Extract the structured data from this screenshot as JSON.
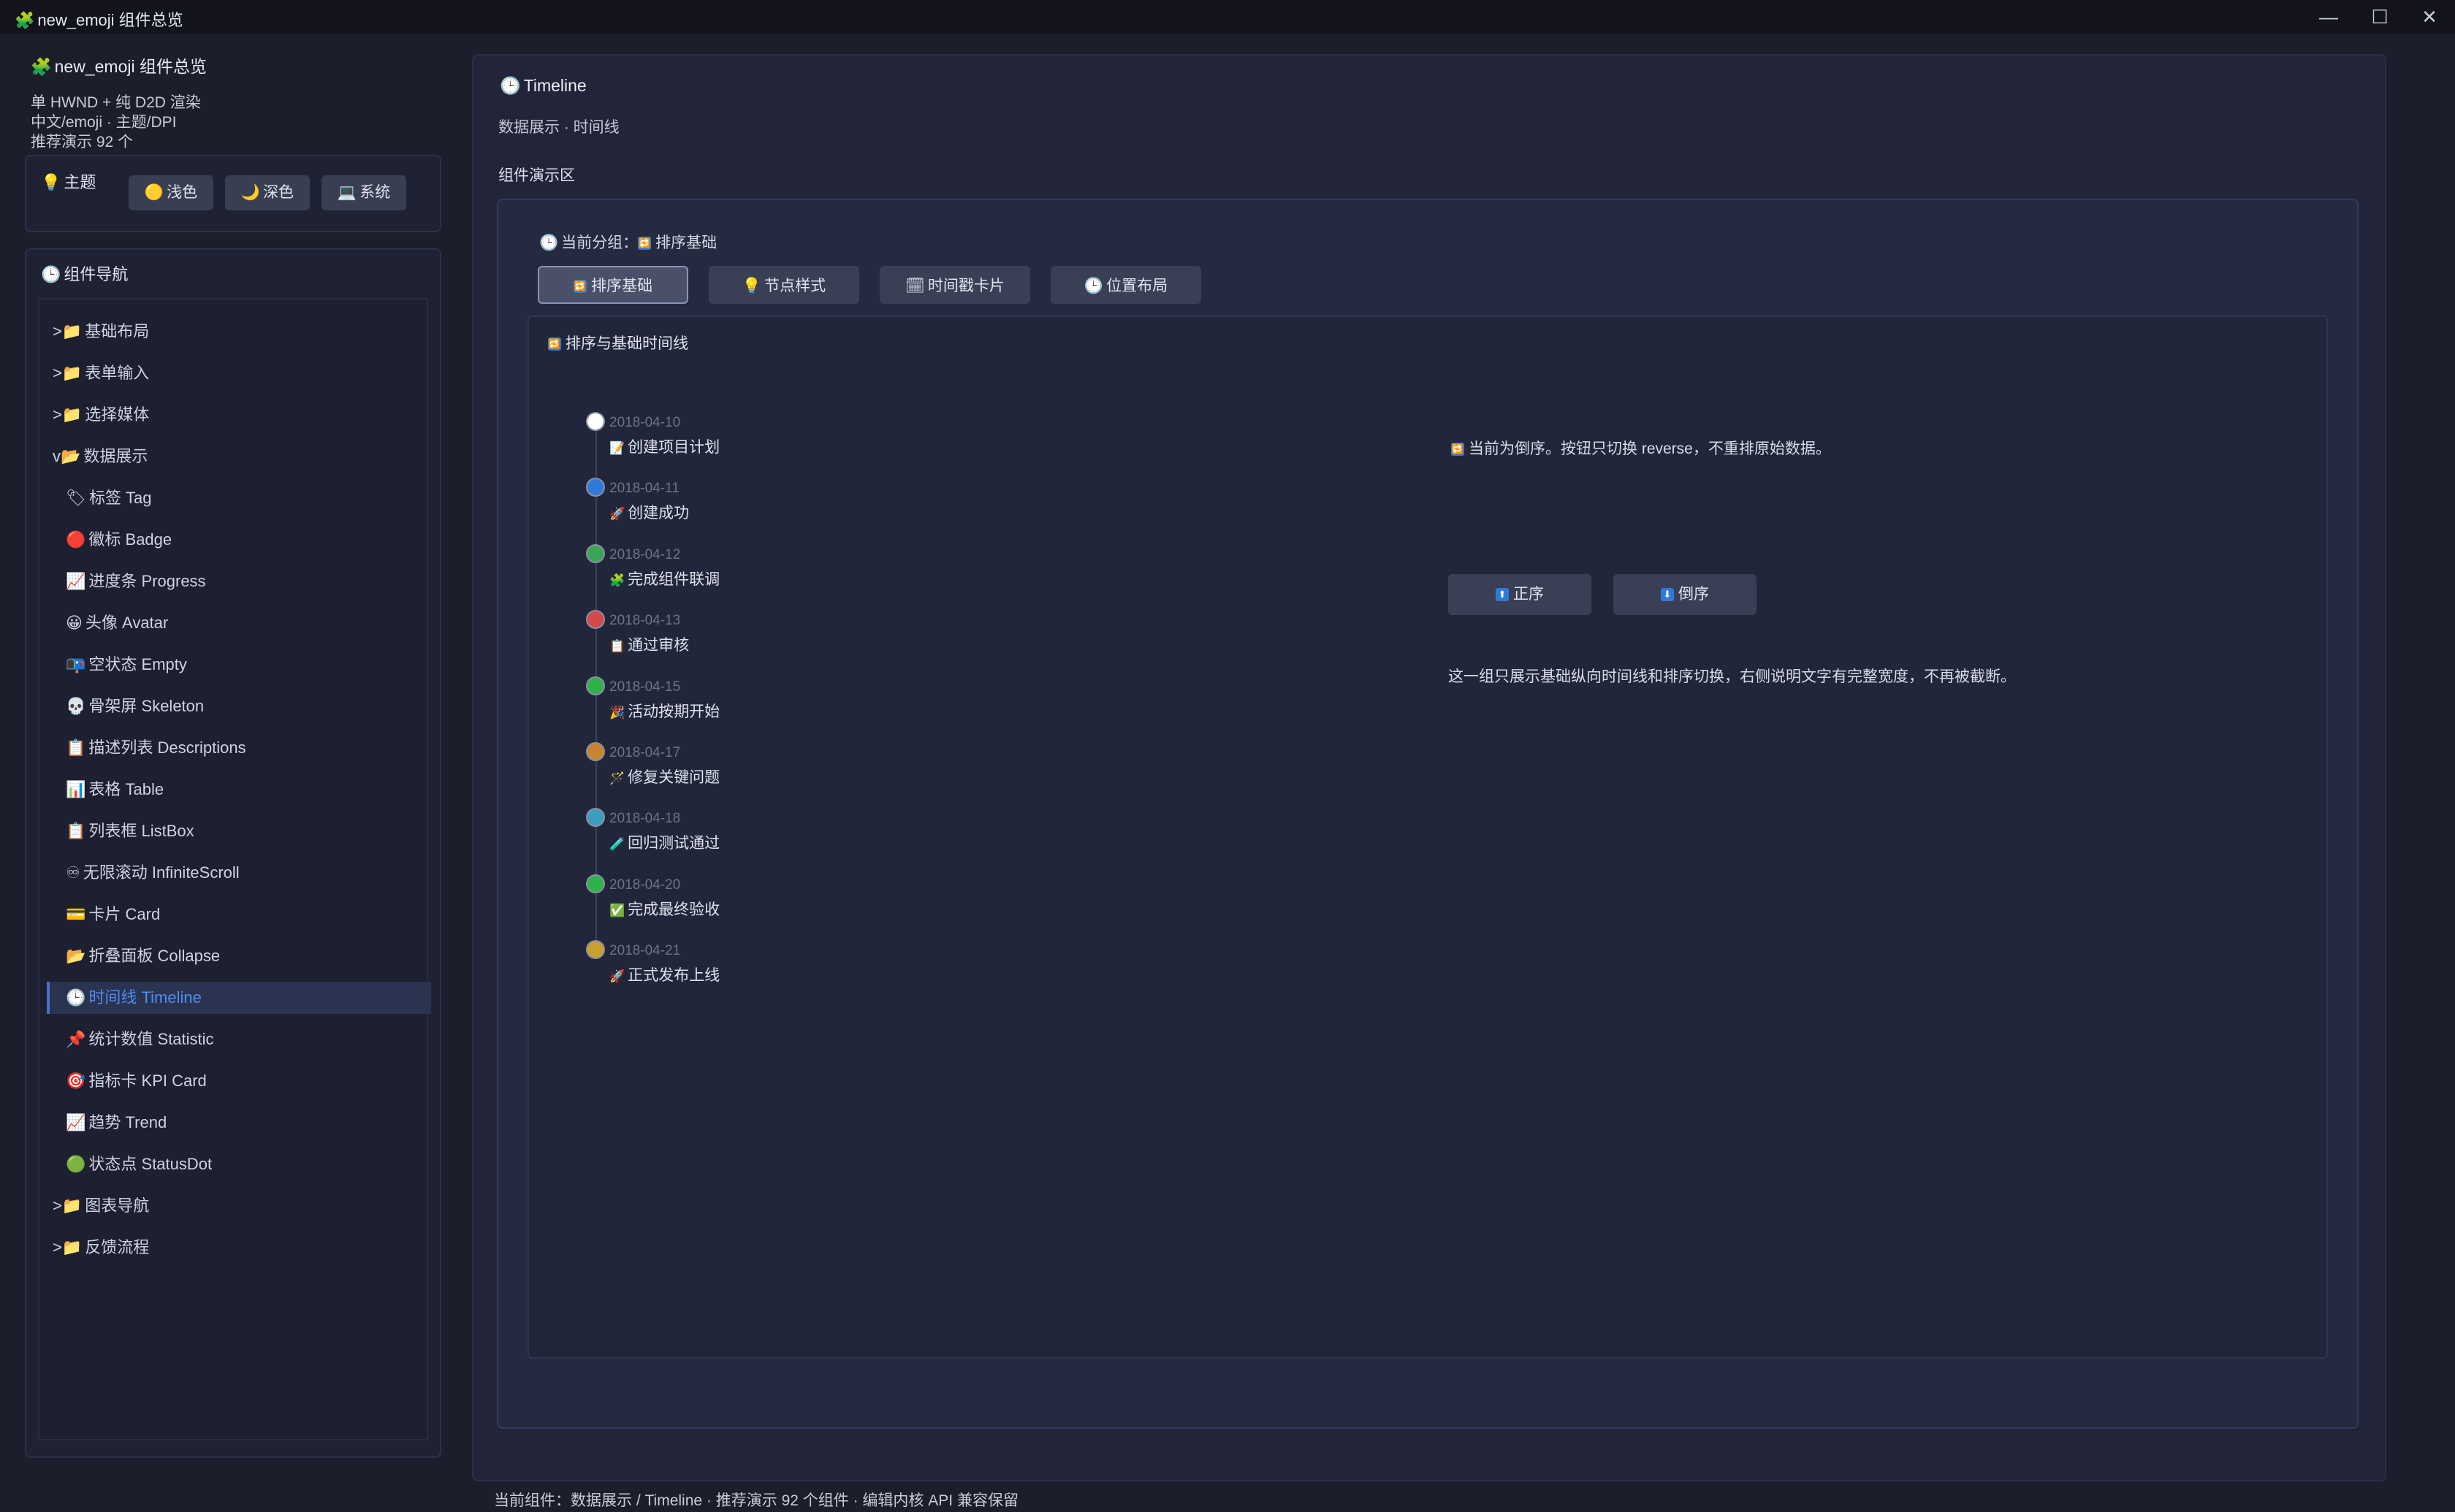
{
  "window": {
    "title": "new_emoji 组件总览",
    "title_icon": "🧩",
    "minimize": "—",
    "maximize": "☐",
    "close": "✕"
  },
  "sidebar": {
    "app_title": "new_emoji 组件总览",
    "app_icon": "🧩",
    "lines": [
      "单 HWND + 纯 D2D 渲染",
      "中文/emoji · 主题/DPI",
      "推荐演示 92 个"
    ],
    "theme": {
      "label": "主题",
      "icon": "💡",
      "buttons": [
        {
          "icon": "🟡",
          "label": "浅色"
        },
        {
          "icon": "🌙",
          "label": "深色"
        },
        {
          "icon": "💻",
          "label": "系统"
        }
      ]
    },
    "nav": {
      "label": "组件导航",
      "icon": "🕒",
      "items": [
        {
          "prefix": ">",
          "icon": "📁",
          "label": "基础布局"
        },
        {
          "prefix": ">",
          "icon": "📁",
          "label": "表单输入"
        },
        {
          "prefix": ">",
          "icon": "📁",
          "label": "选择媒体"
        },
        {
          "prefix": "v",
          "icon": "📂",
          "label": "数据展示"
        },
        {
          "prefix": "",
          "icon": "🏷",
          "label": "标签 Tag"
        },
        {
          "prefix": "",
          "icon": "🔴",
          "label": "徽标 Badge"
        },
        {
          "prefix": "",
          "icon": "📈",
          "label": "进度条 Progress"
        },
        {
          "prefix": "",
          "icon": "😀",
          "label": "头像 Avatar"
        },
        {
          "prefix": "",
          "icon": "📭",
          "label": "空状态 Empty"
        },
        {
          "prefix": "",
          "icon": "💀",
          "label": "骨架屏 Skeleton"
        },
        {
          "prefix": "",
          "icon": "📋",
          "label": "描述列表 Descriptions"
        },
        {
          "prefix": "",
          "icon": "📊",
          "label": "表格 Table"
        },
        {
          "prefix": "",
          "icon": "📋",
          "label": "列表框 ListBox"
        },
        {
          "prefix": "",
          "icon": "♾",
          "label": "无限滚动 InfiniteScroll"
        },
        {
          "prefix": "",
          "icon": "💳",
          "label": "卡片 Card"
        },
        {
          "prefix": "",
          "icon": "📂",
          "label": "折叠面板 Collapse"
        },
        {
          "prefix": "",
          "icon": "🕒",
          "label": "时间线 Timeline",
          "active": true
        },
        {
          "prefix": "",
          "icon": "📌",
          "label": "统计数值 Statistic"
        },
        {
          "prefix": "",
          "icon": "🎯",
          "label": "指标卡 KPI Card"
        },
        {
          "prefix": "",
          "icon": "📈",
          "label": "趋势 Trend"
        },
        {
          "prefix": "",
          "icon": "🟢",
          "label": "状态点 StatusDot"
        },
        {
          "prefix": ">",
          "icon": "📁",
          "label": "图表导航"
        },
        {
          "prefix": ">",
          "icon": "📁",
          "label": "反馈流程"
        }
      ]
    }
  },
  "main": {
    "title": "Timeline",
    "title_icon": "🕒",
    "subtitle": "数据展示 · 时间线",
    "demo_label": "组件演示区",
    "group_line": {
      "icon": "🕒",
      "prefix": "当前分组：",
      "group_icon": "🔁",
      "group": "排序基础"
    },
    "tabs": [
      {
        "icon": "🔁",
        "label": "排序基础",
        "active": true
      },
      {
        "icon": "💡",
        "label": "节点样式"
      },
      {
        "icon": "🗓",
        "label": "时间戳卡片"
      },
      {
        "icon": "🕒",
        "label": "位置布局"
      }
    ],
    "section_title": "排序与基础时间线",
    "section_icon": "🔁",
    "timeline": [
      {
        "date": "2018-04-10",
        "icon": "📝",
        "text": "创建项目计划",
        "color": "#ffffff"
      },
      {
        "date": "2018-04-11",
        "icon": "🚀",
        "text": "创建成功",
        "color": "#2f7ad9"
      },
      {
        "date": "2018-04-12",
        "icon": "🧩",
        "text": "完成组件联调",
        "color": "#3aa655"
      },
      {
        "date": "2018-04-13",
        "icon": "📋",
        "text": "通过审核",
        "color": "#d24a4a"
      },
      {
        "date": "2018-04-15",
        "icon": "🎉",
        "text": "活动按期开始",
        "color": "#2fb24a"
      },
      {
        "date": "2018-04-17",
        "icon": "🪄",
        "text": "修复关键问题",
        "color": "#c8842e"
      },
      {
        "date": "2018-04-18",
        "icon": "🧪",
        "text": "回归测试通过",
        "color": "#3a9fbf"
      },
      {
        "date": "2018-04-20",
        "icon": "✅",
        "text": "完成最终验收",
        "color": "#2fb24a"
      },
      {
        "date": "2018-04-21",
        "icon": "🚀",
        "text": "正式发布上线",
        "color": "#c8a02e"
      }
    ],
    "note1": "当前为倒序。按钮只切换 reverse，不重排原始数据。",
    "note1_icon": "🔁",
    "order_buttons": [
      {
        "icon": "⬆",
        "label": "正序"
      },
      {
        "icon": "⬇",
        "label": "倒序"
      }
    ],
    "note2": "这一组只展示基础纵向时间线和排序切换，右侧说明文字有完整宽度，不再被截断。"
  },
  "statusbar": "当前组件：数据展示 / Timeline · 推荐演示 92 个组件 · 编辑内核 API 兼容保留"
}
